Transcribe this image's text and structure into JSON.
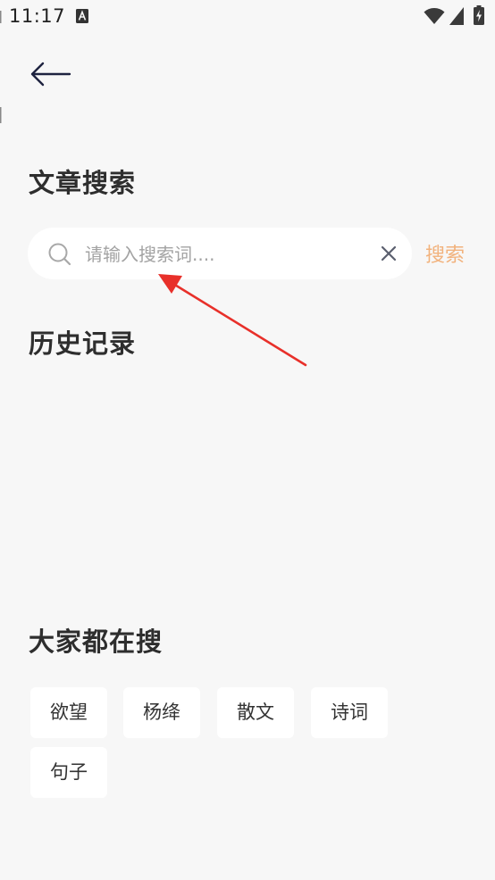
{
  "status_bar": {
    "time": "11:17",
    "notification_icon": "a-notification-icon",
    "icons": [
      "wifi-icon",
      "signal-icon",
      "battery-charging-icon"
    ]
  },
  "header": {
    "back_icon": "arrow-left-icon"
  },
  "page": {
    "title": "文章搜索"
  },
  "search": {
    "placeholder": "请输入搜索词....",
    "value": "",
    "button_label": "搜索",
    "accent_color": "#f2b27c"
  },
  "history": {
    "title": "历史记录",
    "items": []
  },
  "hot_search": {
    "title": "大家都在搜",
    "tags": [
      "欲望",
      "杨绛",
      "散文",
      "诗词",
      "句子"
    ]
  },
  "annotation": {
    "type": "red-arrow",
    "color": "#e8302a"
  }
}
